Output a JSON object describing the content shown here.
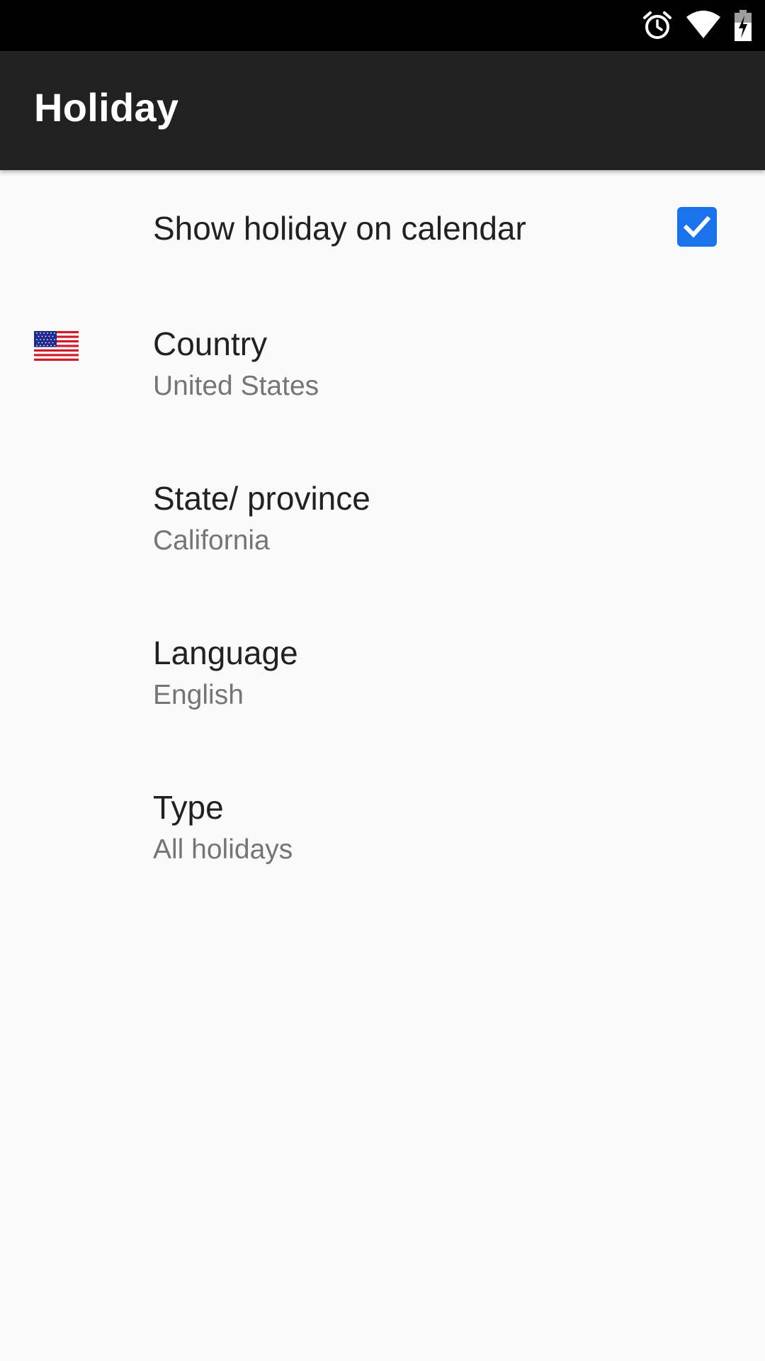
{
  "status_bar": {
    "icons": [
      "alarm-icon",
      "wifi-icon",
      "battery-charging-icon"
    ]
  },
  "toolbar": {
    "title": "Holiday"
  },
  "preferences": {
    "show_holiday": {
      "title": "Show holiday on calendar",
      "checked": true
    },
    "country": {
      "title": "Country",
      "summary": "United States",
      "icon": "us-flag-icon"
    },
    "state": {
      "title": "State/ province",
      "summary": "California"
    },
    "language": {
      "title": "Language",
      "summary": "English"
    },
    "type": {
      "title": "Type",
      "summary": "All holidays"
    }
  },
  "colors": {
    "status_bar": "#000000",
    "toolbar": "#212121",
    "background": "#fafafa",
    "accent": "#1a73e8",
    "title_text": "#212121",
    "summary_text": "#757575"
  }
}
